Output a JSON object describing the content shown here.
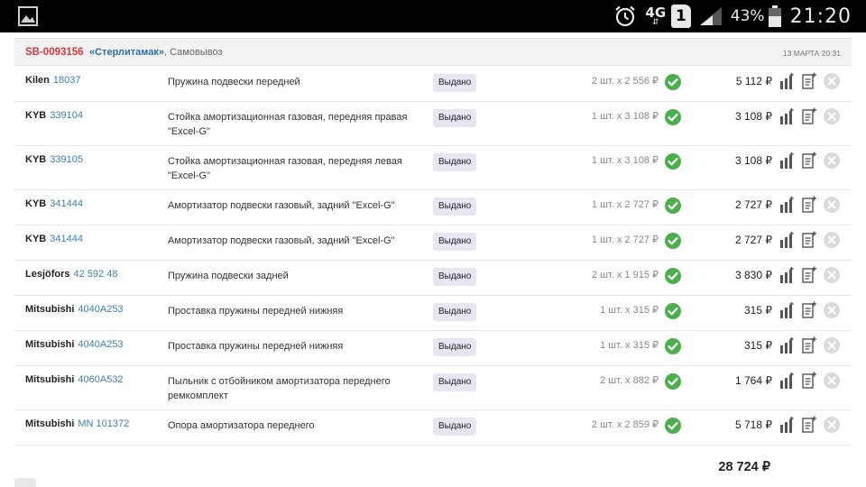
{
  "status_bar": {
    "network": "4G",
    "sim": "1",
    "battery": "43%",
    "time": "21:20"
  },
  "order": {
    "id": "SB-0093156",
    "city": "«Стерлитамак»",
    "delivery": ", Самовывоз",
    "date": "13 МАРТА 20:31"
  },
  "items": [
    {
      "brand": "Kilen",
      "article": "18037",
      "desc": "Пружина подвески передней",
      "status": "Выдано",
      "qty": "2 шт. x 2 556 ₽",
      "sum": "5 112 ₽"
    },
    {
      "brand": "KYB",
      "article": "339104",
      "desc": "Стойка амортизационная газовая, передняя правая \"Excel-G\"",
      "status": "Выдано",
      "qty": "1 шт. x 3 108 ₽",
      "sum": "3 108 ₽"
    },
    {
      "brand": "KYB",
      "article": "339105",
      "desc": "Стойка амортизационная газовая, передняя левая \"Excel-G\"",
      "status": "Выдано",
      "qty": "1 шт. x 3 108 ₽",
      "sum": "3 108 ₽"
    },
    {
      "brand": "KYB",
      "article": "341444",
      "desc": "Амортизатор подвески газовый, задний \"Excel-G\"",
      "status": "Выдано",
      "qty": "1 шт. x 2 727 ₽",
      "sum": "2 727 ₽"
    },
    {
      "brand": "KYB",
      "article": "341444",
      "desc": "Амортизатор подвески газовый, задний \"Excel-G\"",
      "status": "Выдано",
      "qty": "1 шт. x 2 727 ₽",
      "sum": "2 727 ₽"
    },
    {
      "brand": "Lesjöfors",
      "article": "42 592 48",
      "desc": "Пружина подвески задней",
      "status": "Выдано",
      "qty": "2 шт. x 1 915 ₽",
      "sum": "3 830 ₽"
    },
    {
      "brand": "Mitsubishi",
      "article": "4040A253",
      "desc": "Проставка пружины передней нижняя",
      "status": "Выдано",
      "qty": "1 шт. x 315 ₽",
      "sum": "315 ₽"
    },
    {
      "brand": "Mitsubishi",
      "article": "4040A253",
      "desc": "Проставка пружины передней нижняя",
      "status": "Выдано",
      "qty": "1 шт. x 315 ₽",
      "sum": "315 ₽"
    },
    {
      "brand": "Mitsubishi",
      "article": "4060A532",
      "desc": "Пыльник с отбойником амортизатора переднего ремкомплект",
      "status": "Выдано",
      "qty": "2 шт. x 882 ₽",
      "sum": "1 764 ₽"
    },
    {
      "brand": "Mitsubishi",
      "article": "MN 101372",
      "desc": "Опора амортизатора переднего",
      "status": "Выдано",
      "qty": "2 шт. x 2 859 ₽",
      "sum": "5 718 ₽"
    }
  ],
  "total": "28 724 ₽",
  "icons": {
    "status_ok": "check-circle-icon",
    "stats": "bar-chart-icon",
    "note": "add-note-icon",
    "remove": "close-circle-icon"
  },
  "colors": {
    "order_id": "#d9363e",
    "link": "#3b7fb5",
    "status_badge": "#e6e7f3",
    "ok_green": "#4cae4c"
  }
}
